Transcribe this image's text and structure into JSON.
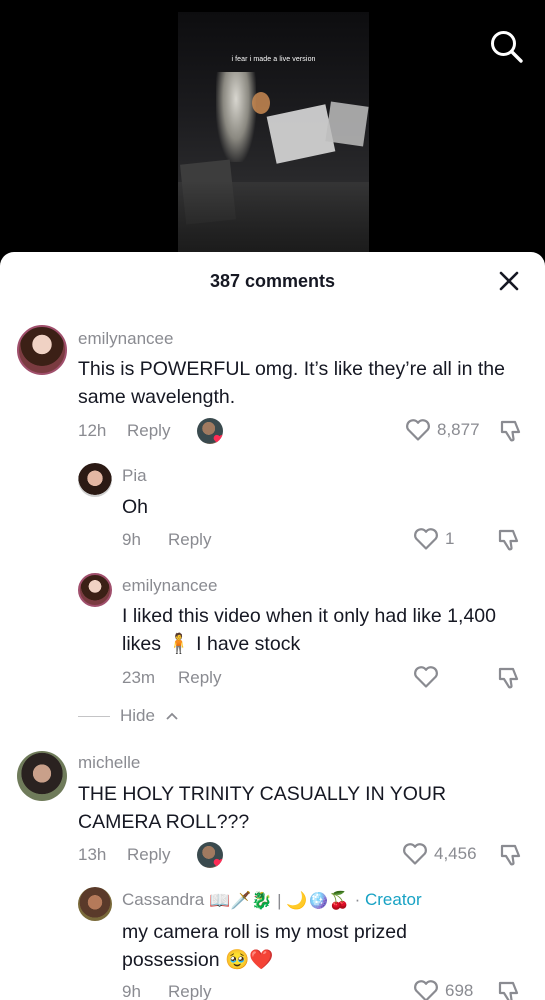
{
  "video": {
    "caption": "i fear i made a live version"
  },
  "sheet": {
    "title": "387 comments"
  },
  "comments": [
    {
      "username": "emilynancee",
      "text": "This is POWERFUL omg. It’s like they’re all in the same wavelength.",
      "time": "12h",
      "reply_label": "Reply",
      "likes": "8,877"
    },
    {
      "username": "Pia",
      "text": "Oh",
      "time": "9h",
      "reply_label": "Reply",
      "likes": "1"
    },
    {
      "username": "emilynancee",
      "text_before": "I liked this video when it only had like 1,400 likes",
      "text_emoji": "🧍",
      "text_after": "I have stock",
      "time": "23m",
      "reply_label": "Reply",
      "likes": ""
    },
    {
      "username": "michelle",
      "text": "THE HOLY TRINITY CASUALLY IN YOUR CAMERA ROLL???",
      "time": "13h",
      "reply_label": "Reply",
      "likes": "4,456"
    },
    {
      "username": "Cassandra",
      "username_emojis": "📖🗡️🐉 | 🌙🪩🍒",
      "separator": "·",
      "creator_label": "Creator",
      "text": "my camera roll is my most prized possession",
      "text_emojis": "🥹❤️",
      "time": "9h",
      "reply_label": "Reply",
      "likes": "698"
    }
  ],
  "hide": {
    "label": "Hide"
  },
  "colors": {
    "text_primary": "#161823",
    "text_secondary": "#8a8b91",
    "creator": "#18a2c4",
    "heart_badge": "#fe2c55"
  },
  "icons": {
    "search": "search-icon",
    "close": "close-icon",
    "like": "heart-outline-icon",
    "dislike": "thumbs-down-icon",
    "liked_by_creator": "creator-avatar-heart-icon",
    "hide_chevron": "chevron-up-icon"
  }
}
